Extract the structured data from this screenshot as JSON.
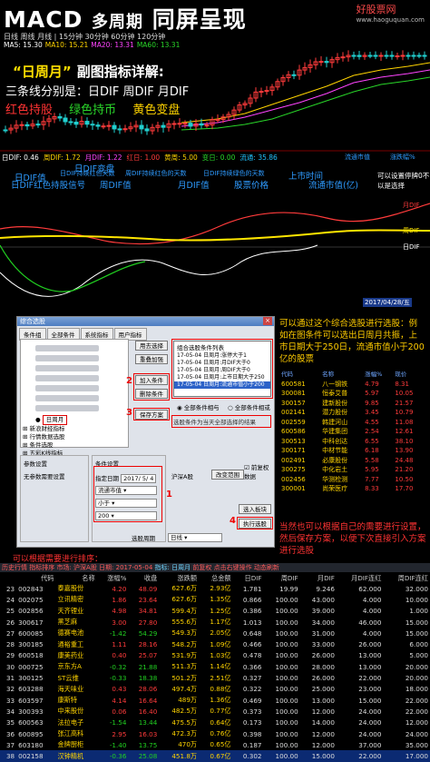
{
  "header": {
    "title_main": "MACD",
    "title_mid": "多周期",
    "title_end": "同屏呈现",
    "watermark": "好股票网",
    "watermark_url": "www.haoguquan.com",
    "tabs_text": "日线 周线 月线 | 15分钟 30分钟 60分钟 120分钟",
    "ma_items": [
      {
        "text": "MA5: 15.30",
        "color": "#ffffff"
      },
      {
        "text": "MA10: 15.21",
        "color": "#ffd400"
      },
      {
        "text": "MA20: 13.31",
        "color": "#ff44ff"
      },
      {
        "text": "MA60: 13.31",
        "color": "#29d629"
      }
    ]
  },
  "annotation": {
    "title": "“日周月”",
    "title_suffix": "副图指标详解:",
    "three_lines": "三条线分别是：日DIF  周DIF  月DIF",
    "red": "红色持股",
    "green": "绿色持币",
    "yellow": "黄色变盘"
  },
  "dif_row": [
    {
      "text": "日DIF: 0.46",
      "color": "#ffffff"
    },
    {
      "text": "周DIF: 1.72",
      "color": "#ffd400"
    },
    {
      "text": "月DIF: 1.22",
      "color": "#ff44ff"
    },
    {
      "text": "红日: 1.00",
      "color": "#ff3b3b"
    },
    {
      "text": "黄周: 5.00",
      "color": "#ffd400"
    },
    {
      "text": "变日: 0.00",
      "color": "#29d629"
    },
    {
      "text": "流通: 35.86",
      "color": "#21c4ff"
    }
  ],
  "labels": [
    "日DIF值",
    "日DIF持续红色天数",
    "日DIF变盘",
    "周DIF持续红色的天数",
    "日DIF持续绿色的天数",
    "上市时间",
    "流通市值",
    "涨跌幅%"
  ],
  "labels2": [
    "日DIF红色持股信号",
    "周DIF值",
    "月DIF值",
    "股票价格",
    "流通市值(亿)",
    "可以设置停牌0不以是选择"
  ],
  "chart2_date": "2017/04/28/五",
  "window": {
    "title": "综合选股",
    "tabs": [
      "条件组",
      "全部条件",
      "系统指标",
      "用户指标"
    ],
    "tree_items": [
      "日周月",
      "新浪财经指标",
      "行情数据选股",
      "条件选股",
      "五彩K线指标"
    ],
    "buttons": [
      "用去选择",
      "重叠加强",
      "加入条件",
      "删除条件",
      "保存方案"
    ],
    "list_head": "组合选股条件列表",
    "list_rows": [
      "17-05-04 日周月:涨停大于1",
      "17-05-04 日周月:月DIF大于0",
      "17-05-04 日周月:周DIF大于0",
      "17-05-04 日周月:上市日期大于250",
      "17-05-04 日周月:流通市值小于200"
    ],
    "radio_all": "全部条件相与",
    "radio_any": "全部条件相或",
    "note": "选股条件为当天全部选择的结果",
    "params_title": "参数设置",
    "params_text": "无参数需要设置",
    "cond_title": "条件设置",
    "period_label": "指定日期",
    "period_value": "2017/ 5/ 4",
    "field1": "流通市值",
    "op": "小于",
    "value": "200",
    "pool_label": "沪深A股",
    "range_btn": "改变范围",
    "remember": "前复权数据",
    "save_btn": "选入板块",
    "run_btn": "执行选股",
    "cycle_label": "选股周期",
    "cycle_value": "日线"
  },
  "note1": {
    "line": "可以通过这个综合选股进行选股：例如在图条件可以选出日周月共振，上市日期大于250日，流通市值小于200亿的股票"
  },
  "note2": "当然也可以根据自己的需要进行设置，然后保存方案，以便下次直接引入方案进行选股",
  "mini_table": {
    "headers": [
      "代码",
      "名称",
      "涨幅%",
      "现价"
    ],
    "rows": [
      [
        "600581",
        "八一钢铁",
        "4.79",
        "8.31"
      ],
      [
        "300081",
        "恒泰艾普",
        "5.97",
        "10.05"
      ],
      [
        "300157",
        "建新股份",
        "9.85",
        "21.57"
      ],
      [
        "002141",
        "潜力股份",
        "3.45",
        "10.79"
      ],
      [
        "002559",
        "韩建河山",
        "4.55",
        "11.08"
      ],
      [
        "600586",
        "华建集团",
        "2.54",
        "12.61"
      ],
      [
        "300513",
        "中科创达",
        "6.55",
        "38.10"
      ],
      [
        "300171",
        "中材节能",
        "6.18",
        "13.90"
      ],
      [
        "002491",
        "必康股份",
        "5.58",
        "24.48"
      ],
      [
        "300275",
        "中化岩土",
        "5.95",
        "21.20"
      ],
      [
        "002456",
        "华测检测",
        "7.77",
        "10.50"
      ],
      [
        "300001",
        "尚荣医疗",
        "8.33",
        "17.70"
      ]
    ]
  },
  "caption": "可以根据需要进行排序：",
  "bottom_head": {
    "prefix": "历史行情 指标排序 市场: 沪深A股 日期: 2017-05-04",
    "mid": "指标: 日周月",
    "suffix": "前复权 点击右键操作 动态刷新"
  },
  "bottom_table": {
    "headers": [
      "",
      "代码",
      "名称",
      "涨幅%",
      "收盘",
      "涨跌额",
      "总金额",
      "日DIF",
      "周DIF",
      "月DIF",
      "月DIF连红",
      "周DIF连红"
    ],
    "rows": [
      [
        "23",
        "002843",
        "泰嘉股份",
        "4.20",
        "48.09",
        "627.6万",
        "2.93亿",
        "1.781",
        "19.99",
        "9.246",
        "62.000",
        "32.000"
      ],
      [
        "24",
        "002075",
        "立讯精密",
        "1.86",
        "23.64",
        "627.6万",
        "1.35亿",
        "0.866",
        "100.00",
        "43.000",
        "4.000",
        "10.000"
      ],
      [
        "25",
        "002856",
        "天齐锂业",
        "4.98",
        "34.81",
        "599.4万",
        "1.25亿",
        "0.386",
        "100.00",
        "39.000",
        "4.000",
        "1.000"
      ],
      [
        "26",
        "300617",
        "黑芝麻",
        "3.00",
        "27.80",
        "555.6万",
        "1.17亿",
        "1.013",
        "100.00",
        "34.000",
        "46.000",
        "15.000"
      ],
      [
        "27",
        "600085",
        "德赛电池",
        "-1.42",
        "54.29",
        "549.3万",
        "2.05亿",
        "0.648",
        "100.00",
        "31.000",
        "4.000",
        "15.000"
      ],
      [
        "28",
        "300185",
        "通裕重工",
        "1.11",
        "28.16",
        "548.2万",
        "1.09亿",
        "0.466",
        "100.00",
        "33.000",
        "26.000",
        "6.000"
      ],
      [
        "29",
        "600518",
        "康美药业",
        "0.40",
        "25.07",
        "531.9万",
        "1.03亿",
        "0.478",
        "100.00",
        "26.000",
        "13.000",
        "5.000"
      ],
      [
        "30",
        "000725",
        "京东方A",
        "-0.32",
        "21.88",
        "511.3万",
        "1.14亿",
        "0.366",
        "100.00",
        "28.000",
        "13.000",
        "20.000"
      ],
      [
        "31",
        "300125",
        "ST云维",
        "-0.33",
        "18.38",
        "501.2万",
        "2.51亿",
        "0.327",
        "100.00",
        "26.000",
        "22.000",
        "20.000"
      ],
      [
        "32",
        "603288",
        "海天味业",
        "0.43",
        "28.06",
        "497.4万",
        "0.88亿",
        "0.322",
        "100.00",
        "25.000",
        "23.000",
        "18.000"
      ],
      [
        "33",
        "603597",
        "康斯特",
        "4.14",
        "16.64",
        "489万",
        "1.36亿",
        "0.469",
        "100.00",
        "13.000",
        "15.000",
        "22.000"
      ],
      [
        "34",
        "300393",
        "中来股份",
        "0.06",
        "16.40",
        "482.5万",
        "0.77亿",
        "0.373",
        "100.00",
        "12.000",
        "24.000",
        "22.000"
      ],
      [
        "35",
        "600563",
        "法拉电子",
        "-1.54",
        "13.44",
        "475.5万",
        "0.64亿",
        "0.173",
        "100.00",
        "14.000",
        "24.000",
        "12.000"
      ],
      [
        "36",
        "600895",
        "张江高科",
        "2.95",
        "16.03",
        "472.3万",
        "0.76亿",
        "0.398",
        "100.00",
        "12.000",
        "24.000",
        "24.000"
      ],
      [
        "37",
        "603180",
        "金牌厨柜",
        "-1.40",
        "13.75",
        "470万",
        "0.65亿",
        "0.187",
        "100.00",
        "12.000",
        "37.000",
        "35.000"
      ],
      [
        "38",
        "002158",
        "汉钟精机",
        "-0.36",
        "25.08",
        "451.8万",
        "0.67亿",
        "0.302",
        "100.00",
        "15.000",
        "22.000",
        "17.000"
      ]
    ]
  }
}
